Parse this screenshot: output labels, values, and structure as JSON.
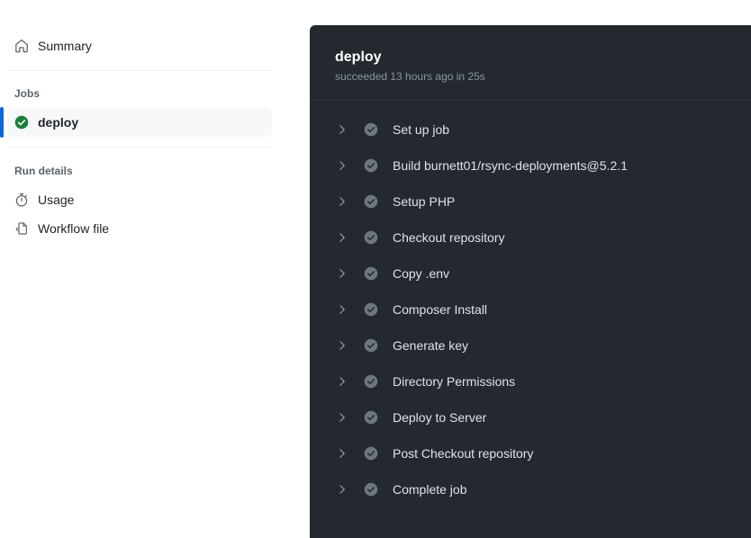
{
  "sidebar": {
    "summary": {
      "label": "Summary",
      "icon": "home-icon"
    },
    "jobs": {
      "heading": "Jobs",
      "items": [
        {
          "label": "deploy",
          "status": "success",
          "icon": "check-circle-green-icon",
          "selected": true
        }
      ]
    },
    "run_details": {
      "heading": "Run details",
      "items": [
        {
          "label": "Usage",
          "icon": "stopwatch-icon"
        },
        {
          "label": "Workflow file",
          "icon": "code-file-icon"
        }
      ]
    }
  },
  "log_panel": {
    "title": "deploy",
    "subtitle": "succeeded 13 hours ago in 25s",
    "steps": [
      {
        "label": "Set up job",
        "status": "success",
        "expand_icon": "chevron-right-icon",
        "status_icon": "check-circle-icon"
      },
      {
        "label": "Build burnett01/rsync-deployments@5.2.1",
        "status": "success",
        "expand_icon": "chevron-right-icon",
        "status_icon": "check-circle-icon"
      },
      {
        "label": "Setup PHP",
        "status": "success",
        "expand_icon": "chevron-right-icon",
        "status_icon": "check-circle-icon"
      },
      {
        "label": "Checkout repository",
        "status": "success",
        "expand_icon": "chevron-right-icon",
        "status_icon": "check-circle-icon"
      },
      {
        "label": "Copy .env",
        "status": "success",
        "expand_icon": "chevron-right-icon",
        "status_icon": "check-circle-icon"
      },
      {
        "label": "Composer Install",
        "status": "success",
        "expand_icon": "chevron-right-icon",
        "status_icon": "check-circle-icon"
      },
      {
        "label": "Generate key",
        "status": "success",
        "expand_icon": "chevron-right-icon",
        "status_icon": "check-circle-icon"
      },
      {
        "label": "Directory Permissions",
        "status": "success",
        "expand_icon": "chevron-right-icon",
        "status_icon": "check-circle-icon"
      },
      {
        "label": "Deploy to Server",
        "status": "success",
        "expand_icon": "chevron-right-icon",
        "status_icon": "check-circle-icon"
      },
      {
        "label": "Post Checkout repository",
        "status": "success",
        "expand_icon": "chevron-right-icon",
        "status_icon": "check-circle-icon"
      },
      {
        "label": "Complete job",
        "status": "success",
        "expand_icon": "chevron-right-icon",
        "status_icon": "check-circle-icon"
      }
    ]
  },
  "colors": {
    "panel_background": "#24292f",
    "panel_divider": "#32383f",
    "success_green": "#1a7f37",
    "step_status_gray": "#6e7681",
    "selection_blue": "#0969da",
    "selected_row_background": "#f6f8fa",
    "page_background": "#ffffff"
  }
}
